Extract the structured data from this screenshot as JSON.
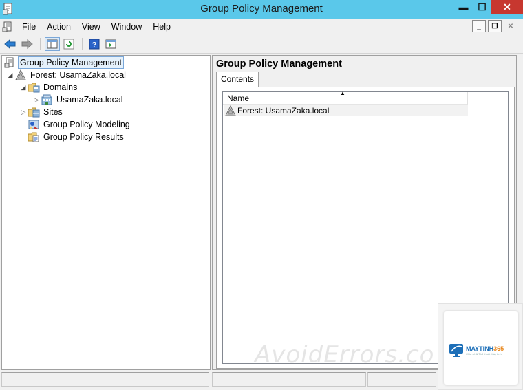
{
  "window": {
    "title": "Group Policy Management",
    "buttons": [
      "minimize-icon",
      "maximize-icon",
      "close-icon"
    ]
  },
  "menu": {
    "items": [
      "File",
      "Action",
      "View",
      "Window",
      "Help"
    ]
  },
  "toolbar": {
    "buttons": [
      "back-arrow-icon",
      "forward-arrow-icon",
      "show-hide-console-tree-icon",
      "refresh-icon",
      "help-icon",
      "action-pane-icon"
    ]
  },
  "tree": {
    "root": "Group Policy Management",
    "forest": "Forest: UsamaZaka.local",
    "domains": "Domains",
    "domain": "UsamaZaka.local",
    "sites": "Sites",
    "modeling": "Group Policy Modeling",
    "results": "Group Policy Results"
  },
  "content": {
    "title": "Group Policy Management",
    "tab": "Contents",
    "column_name": "Name",
    "rows": [
      "Forest: UsamaZaka.local"
    ]
  },
  "watermark": {
    "text": "AvoidErrors.co",
    "brand_main": "MAYTINH",
    "brand_num": "365",
    "tagline": "Chia sẻ & Thủ thuật Máy tính"
  },
  "colors": {
    "titlebar": "#5ac8ea",
    "close": "#c7372f",
    "selection": "#e5f1fb"
  }
}
